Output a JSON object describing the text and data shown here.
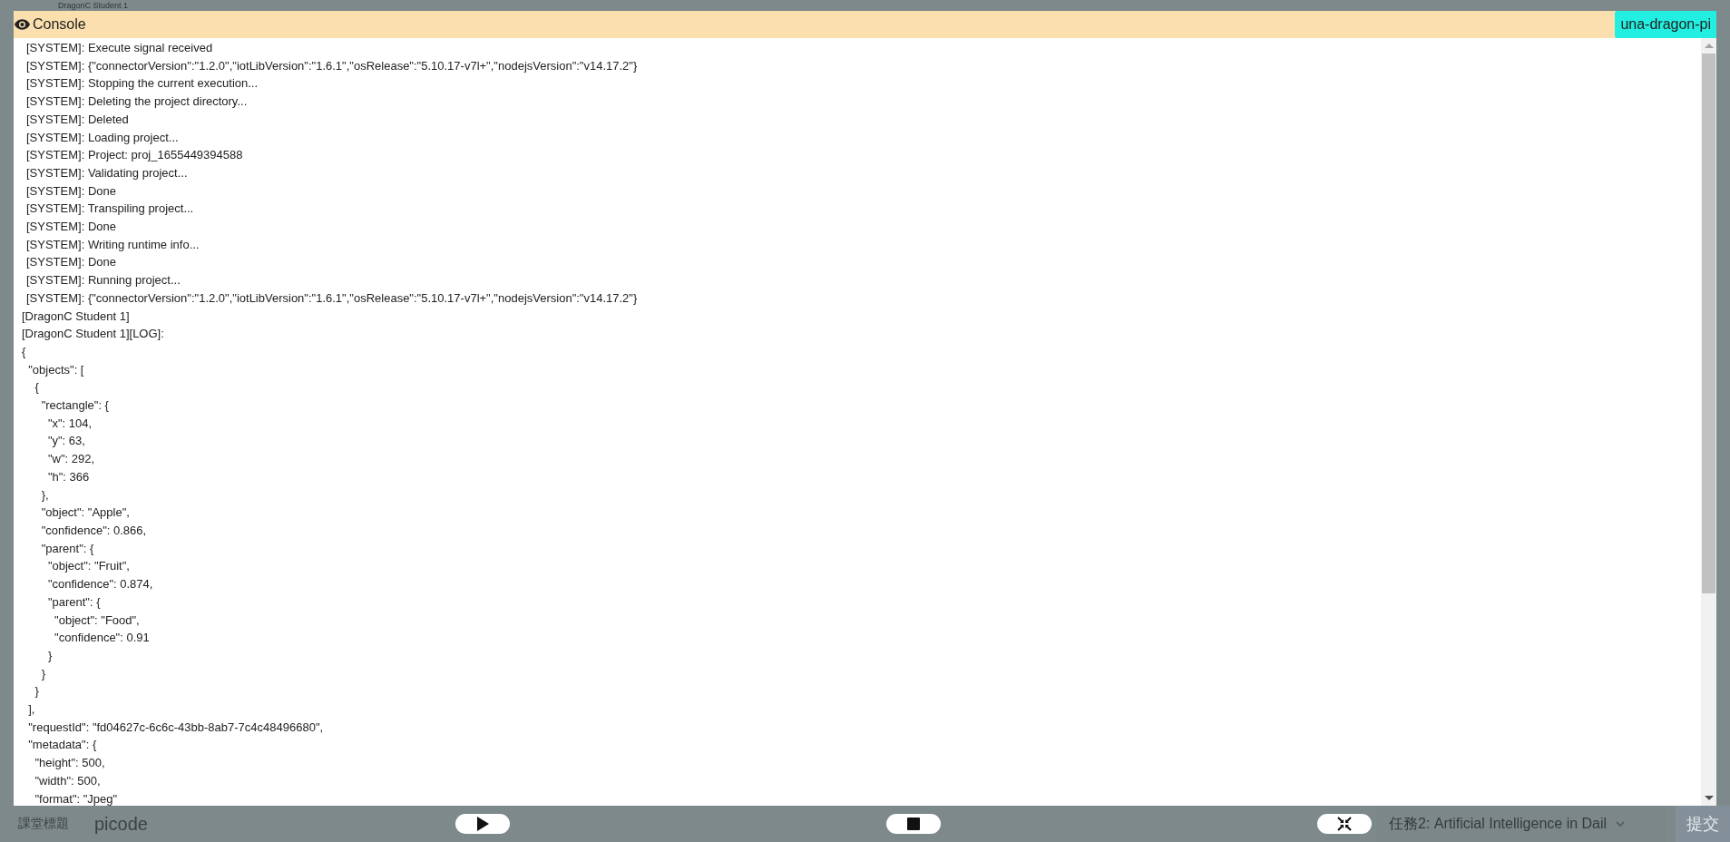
{
  "background": {
    "page_title": "DragonC Student 1",
    "lesson_title": "課堂標題",
    "project_name": "picode",
    "task_select": {
      "value": "任務2: Artificial Intelligence in Dail"
    },
    "submit_button": "提交"
  },
  "console": {
    "title": "Console",
    "device": "una-dragon-pi",
    "lines": [
      {
        "kind": "system",
        "text": "[SYSTEM]: Execute signal received"
      },
      {
        "kind": "system",
        "text": "[SYSTEM]: {\"connectorVersion\":\"1.2.0\",\"iotLibVersion\":\"1.6.1\",\"osRelease\":\"5.10.17-v7l+\",\"nodejsVersion\":\"v14.17.2\"}"
      },
      {
        "kind": "system",
        "text": "[SYSTEM]: Stopping the current execution..."
      },
      {
        "kind": "system",
        "text": "[SYSTEM]: Deleting the project directory..."
      },
      {
        "kind": "system",
        "text": "[SYSTEM]: Deleted"
      },
      {
        "kind": "system",
        "text": "[SYSTEM]: Loading project..."
      },
      {
        "kind": "system",
        "text": "[SYSTEM]: Project: proj_1655449394588"
      },
      {
        "kind": "system",
        "text": "[SYSTEM]: Validating project..."
      },
      {
        "kind": "system",
        "text": "[SYSTEM]: Done"
      },
      {
        "kind": "system",
        "text": "[SYSTEM]: Transpiling project..."
      },
      {
        "kind": "system",
        "text": "[SYSTEM]: Done"
      },
      {
        "kind": "system",
        "text": "[SYSTEM]: Writing runtime info..."
      },
      {
        "kind": "system",
        "text": "[SYSTEM]: Done"
      },
      {
        "kind": "system",
        "text": "[SYSTEM]: Running project..."
      },
      {
        "kind": "system",
        "text": "[SYSTEM]: {\"connectorVersion\":\"1.2.0\",\"iotLibVersion\":\"1.6.1\",\"osRelease\":\"5.10.17-v7l+\",\"nodejsVersion\":\"v14.17.2\"}"
      },
      {
        "kind": "device",
        "text": "[DragonC Student 1]"
      },
      {
        "kind": "device",
        "text": "[DragonC Student 1][LOG]:"
      },
      {
        "kind": "device",
        "text": "{"
      },
      {
        "kind": "device",
        "text": "  \"objects\": ["
      },
      {
        "kind": "device",
        "text": "    {"
      },
      {
        "kind": "device",
        "text": "      \"rectangle\": {"
      },
      {
        "kind": "device",
        "text": "        \"x\": 104,"
      },
      {
        "kind": "device",
        "text": "        \"y\": 63,"
      },
      {
        "kind": "device",
        "text": "        \"w\": 292,"
      },
      {
        "kind": "device",
        "text": "        \"h\": 366"
      },
      {
        "kind": "device",
        "text": "      },"
      },
      {
        "kind": "device",
        "text": "      \"object\": \"Apple\","
      },
      {
        "kind": "device",
        "text": "      \"confidence\": 0.866,"
      },
      {
        "kind": "device",
        "text": "      \"parent\": {"
      },
      {
        "kind": "device",
        "text": "        \"object\": \"Fruit\","
      },
      {
        "kind": "device",
        "text": "        \"confidence\": 0.874,"
      },
      {
        "kind": "device",
        "text": "        \"parent\": {"
      },
      {
        "kind": "device",
        "text": "          \"object\": \"Food\","
      },
      {
        "kind": "device",
        "text": "          \"confidence\": 0.91"
      },
      {
        "kind": "device",
        "text": "        }"
      },
      {
        "kind": "device",
        "text": "      }"
      },
      {
        "kind": "device",
        "text": "    }"
      },
      {
        "kind": "device",
        "text": "  ],"
      },
      {
        "kind": "device",
        "text": "  \"requestId\": \"fd04627c-6c6c-43bb-8ab7-7c4c48496680\","
      },
      {
        "kind": "device",
        "text": "  \"metadata\": {"
      },
      {
        "kind": "device",
        "text": "    \"height\": 500,"
      },
      {
        "kind": "device",
        "text": "    \"width\": 500,"
      },
      {
        "kind": "device",
        "text": "    \"format\": \"Jpeg\""
      }
    ],
    "controls": [
      {
        "kind": "play"
      },
      {
        "kind": "stop"
      },
      {
        "kind": "collapse"
      }
    ]
  }
}
